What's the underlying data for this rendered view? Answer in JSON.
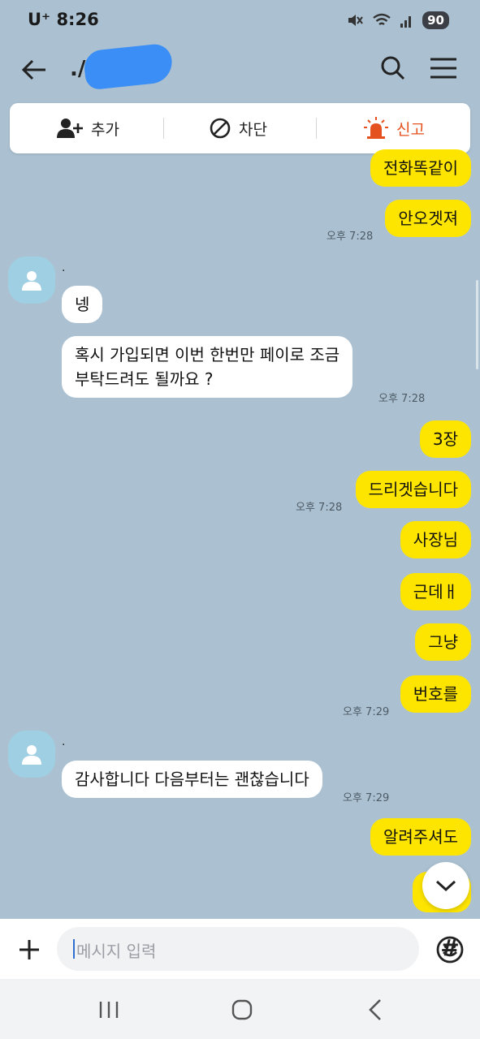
{
  "status": {
    "carrier_time": "U⁺ 8:26",
    "battery": "90"
  },
  "header": {
    "title": "./"
  },
  "actions": {
    "add_label": "추가",
    "block_label": "차단",
    "report_label": "신고"
  },
  "messages": [
    {
      "from": "me",
      "text": "전화똑같이"
    },
    {
      "from": "me",
      "text": "안오겟져",
      "time": "오후 7:28"
    },
    {
      "from": "them",
      "sender": ".",
      "text": "넹"
    },
    {
      "from": "them",
      "text_line1": "혹시 가입되면 이번 한번만 페이로 조금",
      "text_line2": "부탁드려도 될까요 ?",
      "time": "오후 7:28"
    },
    {
      "from": "me",
      "text": "3장"
    },
    {
      "from": "me",
      "text": "드리겟습니다",
      "time": "오후 7:28"
    },
    {
      "from": "me",
      "text": "사장님"
    },
    {
      "from": "me",
      "text": "근데ㅐ"
    },
    {
      "from": "me",
      "text": "그냥"
    },
    {
      "from": "me",
      "text": "번호를",
      "time": "오후 7:29"
    },
    {
      "from": "them",
      "sender": ".",
      "text": "감사합니다 다음부터는 괜찮습니다",
      "time": "오후 7:29"
    },
    {
      "from": "me",
      "text": "알려주셔도"
    }
  ],
  "input": {
    "placeholder": "메시지 입력"
  },
  "colors": {
    "background": "#abc1d1",
    "my_bubble": "#fee500",
    "their_bubble": "#ffffff",
    "report_accent": "#e4511e"
  }
}
